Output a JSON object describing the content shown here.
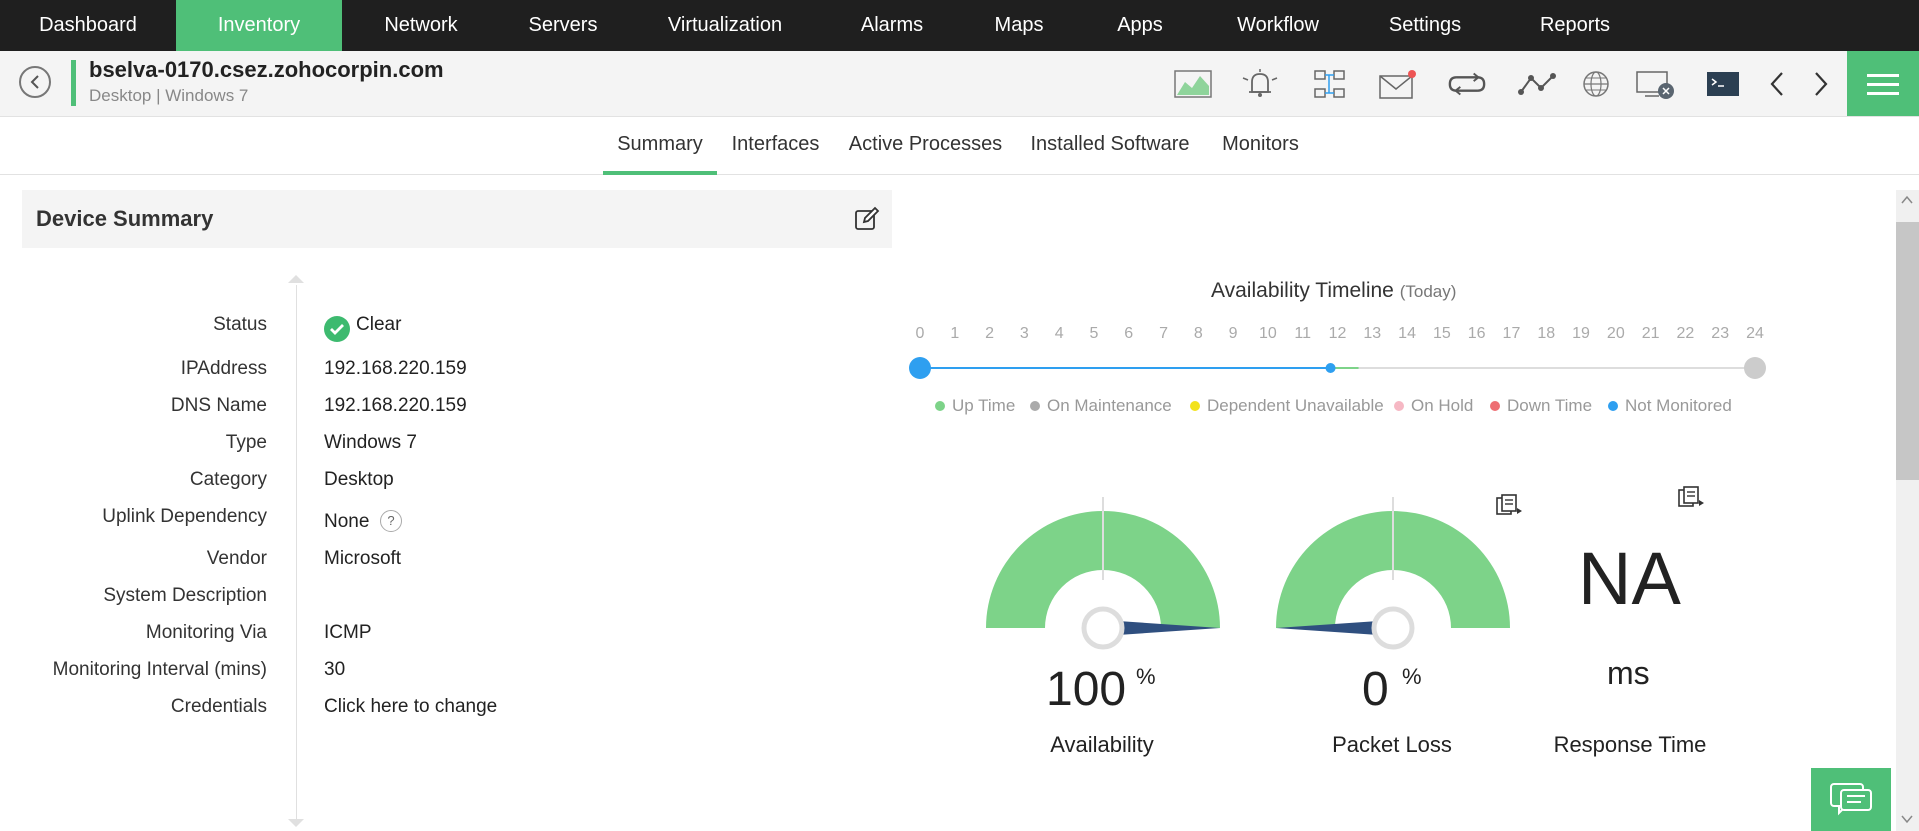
{
  "nav": {
    "items": [
      {
        "label": "Dashboard"
      },
      {
        "label": "Inventory"
      },
      {
        "label": "Network"
      },
      {
        "label": "Servers"
      },
      {
        "label": "Virtualization"
      },
      {
        "label": "Alarms"
      },
      {
        "label": "Maps"
      },
      {
        "label": "Apps"
      },
      {
        "label": "Workflow"
      },
      {
        "label": "Settings"
      },
      {
        "label": "Reports"
      }
    ],
    "active": "Inventory"
  },
  "device": {
    "name": "bselva-0170.csez.zohocorpin.com",
    "subtitle": "Desktop | Windows 7"
  },
  "toolbar": {
    "icons": [
      "graph-icon",
      "alarm-bell-icon",
      "config-icon",
      "mail-icon",
      "sync-icon",
      "route-icon",
      "globe-icon",
      "remote-desktop-icon",
      "terminal-icon",
      "prev-arrow-icon",
      "next-arrow-icon"
    ]
  },
  "tabs": {
    "items": [
      {
        "label": "Summary"
      },
      {
        "label": "Interfaces"
      },
      {
        "label": "Active Processes"
      },
      {
        "label": "Installed Software"
      },
      {
        "label": "Monitors"
      }
    ],
    "active": "Summary"
  },
  "summary": {
    "title": "Device Summary",
    "properties": [
      {
        "label": "Status",
        "value": "Clear"
      },
      {
        "label": "IPAddress",
        "value": "192.168.220.159"
      },
      {
        "label": "DNS Name",
        "value": "192.168.220.159"
      },
      {
        "label": "Type",
        "value": "Windows 7"
      },
      {
        "label": "Category",
        "value": "Desktop"
      },
      {
        "label": "Uplink Dependency",
        "value": "None"
      },
      {
        "label": "Vendor",
        "value": "Microsoft"
      },
      {
        "label": "System Description",
        "value": ""
      },
      {
        "label": "Monitoring Via",
        "value": "ICMP"
      },
      {
        "label": "Monitoring Interval (mins)",
        "value": "30"
      },
      {
        "label": "Credentials",
        "value": "Click here to change"
      }
    ],
    "help_mark": "?"
  },
  "timeline": {
    "title": "Availability Timeline",
    "period": "(Today)",
    "hours": [
      "0",
      "1",
      "2",
      "3",
      "4",
      "5",
      "6",
      "7",
      "8",
      "9",
      "10",
      "11",
      "12",
      "13",
      "14",
      "15",
      "16",
      "17",
      "18",
      "19",
      "20",
      "21",
      "22",
      "23",
      "24"
    ],
    "current_hour": 11.8,
    "legend": [
      {
        "label": "Up Time",
        "color": "#7dd389"
      },
      {
        "label": "On Maintenance",
        "color": "#aaaaaa"
      },
      {
        "label": "Dependent Unavailable",
        "color": "#f2e21b"
      },
      {
        "label": "On Hold",
        "color": "#f6b8c4"
      },
      {
        "label": "Down Time",
        "color": "#ee6e73"
      },
      {
        "label": "Not Monitored",
        "color": "#2e9ff0"
      }
    ]
  },
  "gauges": {
    "availability": {
      "value": "100",
      "unit": "%",
      "label": "Availability",
      "level": 100
    },
    "packet_loss": {
      "value": "0",
      "unit": "%",
      "label": "Packet Loss",
      "level": 0
    },
    "response_time": {
      "value": "NA",
      "unit": "ms",
      "label": "Response Time"
    }
  },
  "colors": {
    "accent": "#4fbf78",
    "gauge_fill": "#7dd389",
    "needle": "#2f4f7f"
  }
}
